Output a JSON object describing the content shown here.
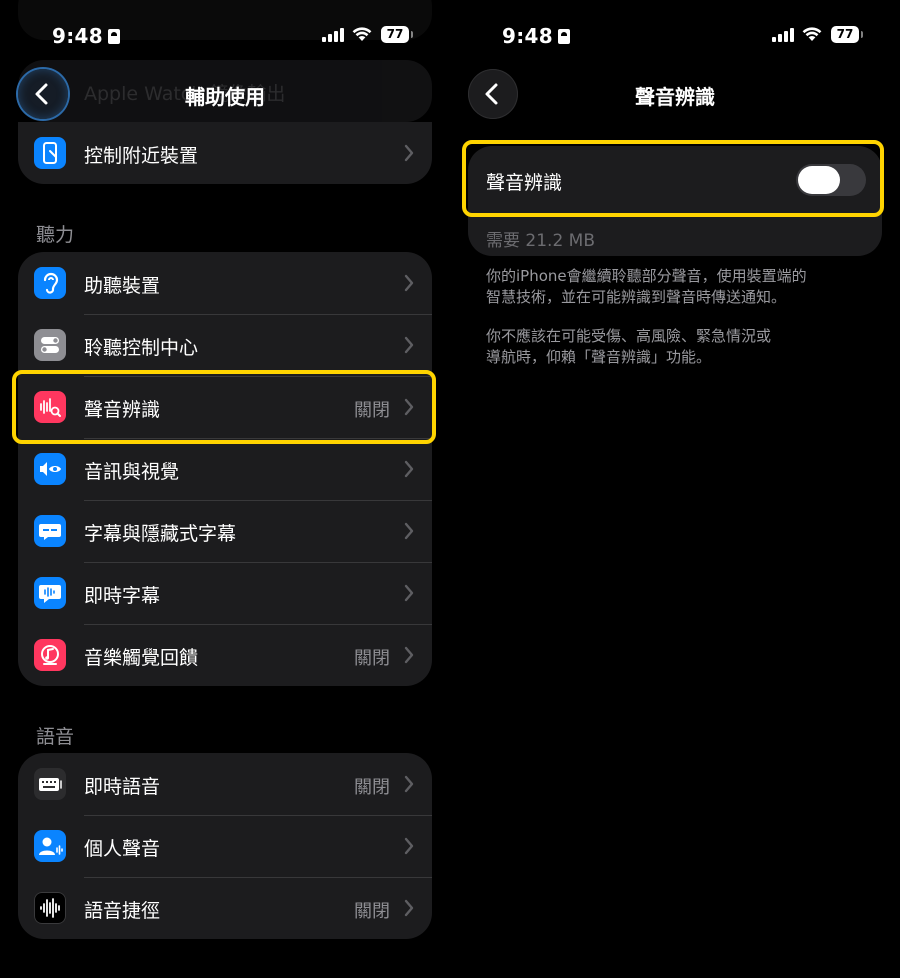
{
  "left": {
    "status": {
      "time": "9:48",
      "battery": "77"
    },
    "ghost_rows": [
      "Apple Watch 鏡像輸出"
    ],
    "nav_title": "輔助使用",
    "top_card": [
      {
        "label": "控制附近裝置",
        "icon": "device-control-icon",
        "color": "#0a84ff"
      }
    ],
    "hearing": {
      "header": "聽力",
      "items": [
        {
          "label": "助聽裝置",
          "value": "",
          "icon": "ear-icon",
          "color": "#0a84ff"
        },
        {
          "label": "聆聽控制中心",
          "value": "",
          "icon": "toggles-icon",
          "color": "#8e8e93"
        },
        {
          "label": "聲音辨識",
          "value": "關閉",
          "icon": "sound-recognition-icon",
          "color": "#ff375f"
        },
        {
          "label": "音訊與視覺",
          "value": "",
          "icon": "speaker-eye-icon",
          "color": "#0a84ff"
        },
        {
          "label": "字幕與隱藏式字幕",
          "value": "",
          "icon": "captions-icon",
          "color": "#0a84ff"
        },
        {
          "label": "即時字幕",
          "value": "",
          "icon": "live-captions-icon",
          "color": "#0a84ff"
        },
        {
          "label": "音樂觸覺回饋",
          "value": "關閉",
          "icon": "music-haptics-icon",
          "color": "#ff375f"
        }
      ]
    },
    "speech": {
      "header": "語音",
      "items": [
        {
          "label": "即時語音",
          "value": "關閉",
          "icon": "keyboard-icon",
          "color": "#2c2c2e"
        },
        {
          "label": "個人聲音",
          "value": "",
          "icon": "personal-voice-icon",
          "color": "#0a84ff"
        },
        {
          "label": "語音捷徑",
          "value": "關閉",
          "icon": "waveform-icon",
          "color": "#2c2c2e"
        }
      ]
    }
  },
  "right": {
    "status": {
      "time": "9:48",
      "battery": "77"
    },
    "nav_title": "聲音辨識",
    "toggle_label": "聲音辨識",
    "toggle_on": false,
    "size_note": "需要 21.2 MB",
    "desc1": [
      "你的iPhone會繼續聆聽部分聲音，使用裝置端的",
      "智慧技術，並在可能辨識到聲音時傳送通知。"
    ],
    "desc2": [
      "你不應該在可能受傷、高風險、緊急情況或",
      "導航時，仰賴「聲音辨識」功能。"
    ]
  },
  "colors": {
    "highlight": "#ffd400",
    "card": "#1c1c1e",
    "secondary": "#8e8e93"
  }
}
